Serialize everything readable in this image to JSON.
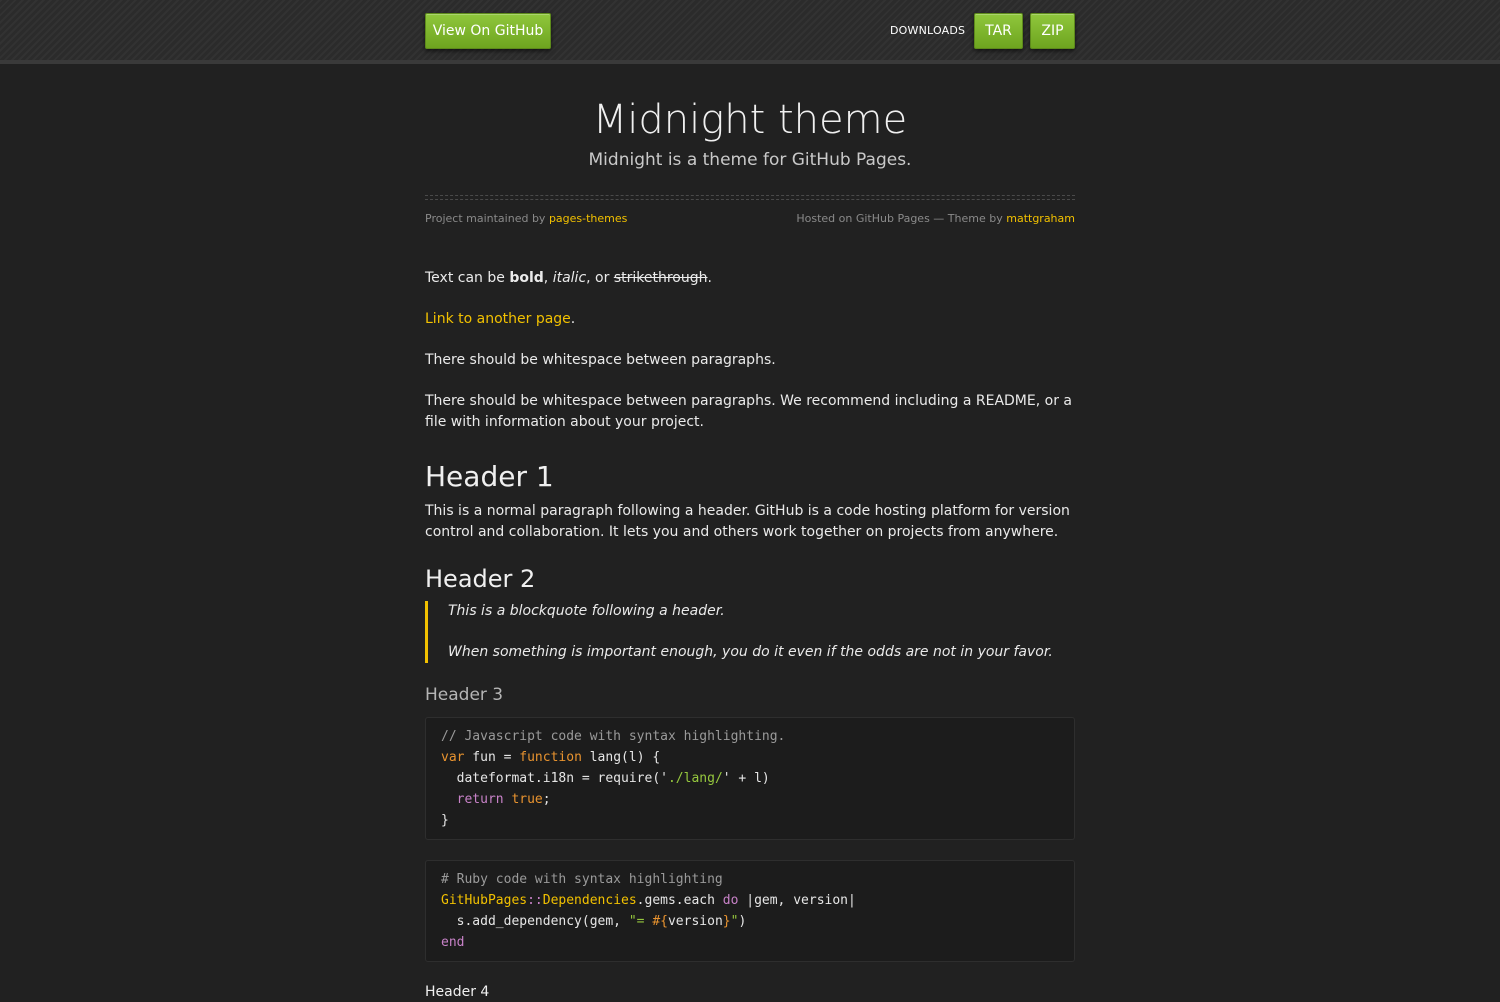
{
  "topbar": {
    "github_button": "View On GitHub",
    "downloads_label": "DOWNLOADS",
    "tar_button": "TAR",
    "zip_button": "ZIP"
  },
  "header": {
    "title": "Midnight theme",
    "subtitle": "Midnight is a theme for GitHub Pages.",
    "credits_left_prefix": "Project maintained by ",
    "credits_left_link": "pages-themes",
    "credits_right_prefix": "Hosted on GitHub Pages — Theme by ",
    "credits_right_link": "mattgraham"
  },
  "content": {
    "p1": {
      "a": "Text can be ",
      "bold": "bold",
      "b": ", ",
      "italic": "italic",
      "c": ", or ",
      "strike": "strikethrough",
      "d": "."
    },
    "link_line": {
      "link": "Link to another page",
      "after": "."
    },
    "p2": "There should be whitespace between paragraphs.",
    "p3": "There should be whitespace between paragraphs. We recommend including a README, or a file with information about your project.",
    "h1": "Header 1",
    "p4": "This is a normal paragraph following a header. GitHub is a code hosting platform for version control and collaboration. It lets you and others work together on projects from anywhere.",
    "h2": "Header 2",
    "quote1": "This is a blockquote following a header.",
    "quote2": "When something is important enough, you do it even if the odds are not in your favor.",
    "h3": "Header 3",
    "js_code": {
      "comment": "// Javascript code with syntax highlighting.",
      "l2_var": "var",
      "l2_mid": " fun = ",
      "l2_fn": "function",
      "l2_end": " lang(l) {",
      "l3_a": "  dateformat.i18n = require('",
      "l3_str": "./lang/",
      "l3_b": "' + l)",
      "l4_indent": "  ",
      "l4_return": "return",
      "l4_space": " ",
      "l4_true": "true",
      "l4_end": ";",
      "l5": "}"
    },
    "ruby_code": {
      "comment": "# Ruby code with syntax highlighting",
      "l2_cls1": "GitHubPages",
      "l2_sep": "::",
      "l2_cls2": "Dependencies",
      "l2_mid": ".gems.each ",
      "l2_do": "do",
      "l2_end": " |gem, version|",
      "l3_a": "  s.add_dependency(gem, ",
      "l3_str": "\"= ",
      "l3_interp": "#{",
      "l3_var": "version",
      "l3_close": "}",
      "l3_str_end": "\"",
      "l3_end": ")",
      "l4_end": "end"
    },
    "h4": "Header 4"
  },
  "colors": {
    "background": "#212121",
    "accent_link": "#f2c100",
    "button_green": "#7ab62c"
  }
}
